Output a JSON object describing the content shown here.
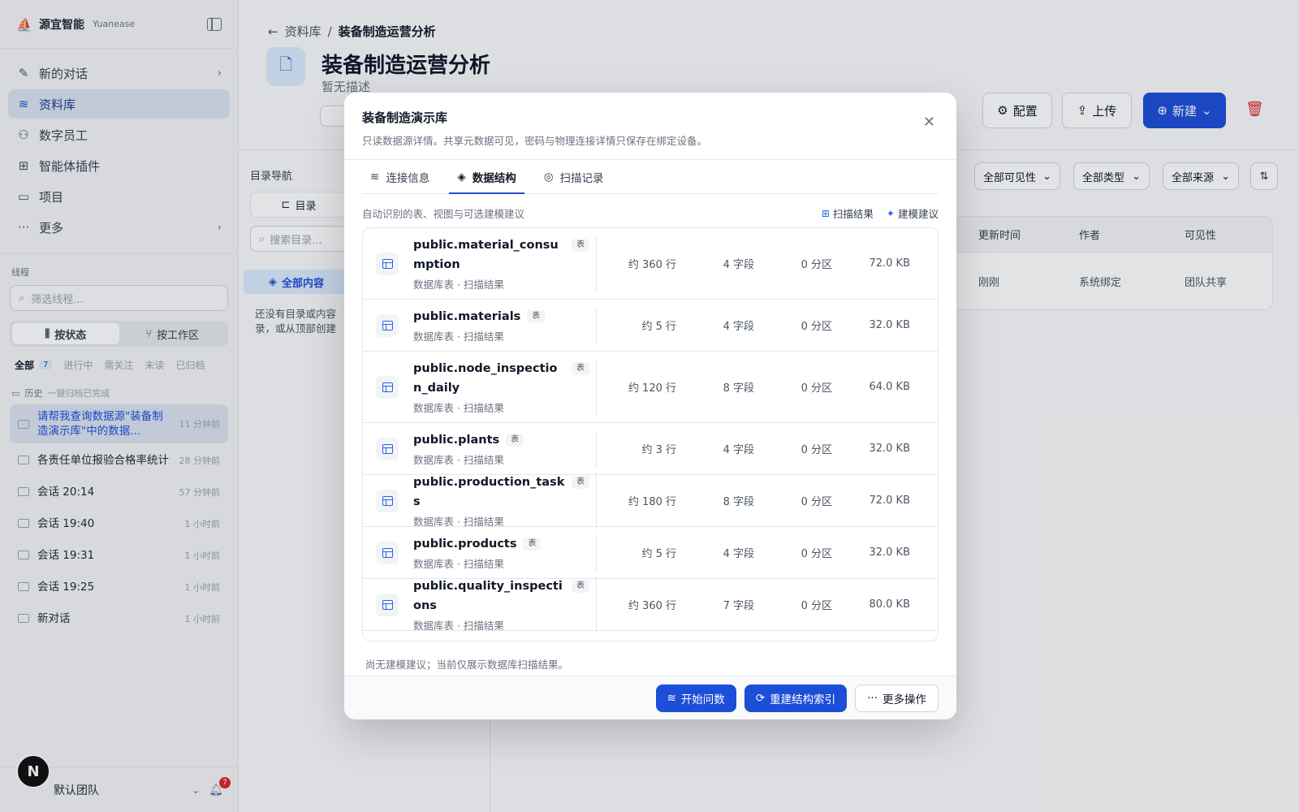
{
  "sidebar": {
    "brand_name": "源宜智能",
    "brand_en": "Yuanease",
    "nav": [
      {
        "label": "新的对话"
      },
      {
        "label": "资料库"
      },
      {
        "label": "数字员工"
      },
      {
        "label": "智能体插件"
      },
      {
        "label": "项目"
      },
      {
        "label": "更多"
      }
    ],
    "threads_label": "线程",
    "filter_placeholder": "筛选线程...",
    "seg_status": "按状态",
    "seg_workspace": "按工作区",
    "chips": {
      "all": "全部",
      "all_count": "7",
      "in_progress": "进行中",
      "watch": "需关注",
      "unread": "未读",
      "archived": "已归档"
    },
    "history_label": "历史",
    "history_sub": "一键归档已完成",
    "threads": [
      {
        "title": "请帮我查询数据源\"装备制造演示库\"中的数据...",
        "time": "11 分钟前"
      },
      {
        "title": "各责任单位报验合格率统计",
        "time": "28 分钟前"
      },
      {
        "title": "会话 20:14",
        "time": "57 分钟前"
      },
      {
        "title": "会话 19:40",
        "time": "1 小时前"
      },
      {
        "title": "会话 19:31",
        "time": "1 小时前"
      },
      {
        "title": "会话 19:25",
        "time": "1 小时前"
      },
      {
        "title": "新对话",
        "time": "1 小时前"
      }
    ],
    "avatar": "N",
    "team": "默认团队",
    "bell_count": "7"
  },
  "main": {
    "back": "资料库",
    "sep": "/",
    "crumb_current": "装备制造运营分析",
    "title": "装备制造运营分析",
    "desc": "暂无描述",
    "btn_config": "配置",
    "btn_upload": "上传",
    "btn_new": "新建",
    "dir_label": "目录导航",
    "dir_tab": "目录",
    "dir_search": "搜索目录...",
    "all_content": "全部内容",
    "empty_1": "还没有目录或内容",
    "empty_2": "录，或从顶部创建",
    "sel_visibility": "全部可见性",
    "sel_type": "全部类型",
    "sel_source": "全部来源",
    "table": {
      "headers": [
        "更新时间",
        "作者",
        "可见性"
      ],
      "row": [
        "刚刚",
        "系统绑定",
        "团队共享"
      ]
    }
  },
  "modal": {
    "title": "装备制造演示库",
    "subtitle": "只读数据源详情。共享元数据可见，密码与物理连接详情只保存在绑定设备。",
    "tabs": [
      "连接信息",
      "数据结构",
      "扫描记录"
    ],
    "hint": "自动识别的表、视图与可选建模建议",
    "link_scan": "扫描结果",
    "link_model": "建模建议",
    "tables": [
      {
        "name": "public.material_consumption",
        "tag": "表",
        "meta": "数据库表 · 扫描结果",
        "rows": "约 360 行",
        "fields": "4 字段",
        "parts": "0 分区",
        "size": "72.0 KB"
      },
      {
        "name": "public.materials",
        "tag": "表",
        "meta": "数据库表 · 扫描结果",
        "rows": "约 5 行",
        "fields": "4 字段",
        "parts": "0 分区",
        "size": "32.0 KB"
      },
      {
        "name": "public.node_inspection_daily",
        "tag": "表",
        "meta": "数据库表 · 扫描结果",
        "rows": "约 120 行",
        "fields": "8 字段",
        "parts": "0 分区",
        "size": "64.0 KB"
      },
      {
        "name": "public.plants",
        "tag": "表",
        "meta": "数据库表 · 扫描结果",
        "rows": "约 3 行",
        "fields": "4 字段",
        "parts": "0 分区",
        "size": "32.0 KB"
      },
      {
        "name": "public.production_tasks",
        "tag": "表",
        "meta": "数据库表 · 扫描结果",
        "rows": "约 180 行",
        "fields": "8 字段",
        "parts": "0 分区",
        "size": "72.0 KB"
      },
      {
        "name": "public.products",
        "tag": "表",
        "meta": "数据库表 · 扫描结果",
        "rows": "约 5 行",
        "fields": "4 字段",
        "parts": "0 分区",
        "size": "32.0 KB"
      },
      {
        "name": "public.quality_inspections",
        "tag": "表",
        "meta": "数据库表 · 扫描结果",
        "rows": "约 360 行",
        "fields": "7 字段",
        "parts": "0 分区",
        "size": "80.0 KB"
      }
    ],
    "note": "尚无建模建议；当前仅展示数据库扫描结果。",
    "btn_ask": "开始问数",
    "btn_rebuild": "重建结构索引",
    "btn_more": "更多操作"
  }
}
